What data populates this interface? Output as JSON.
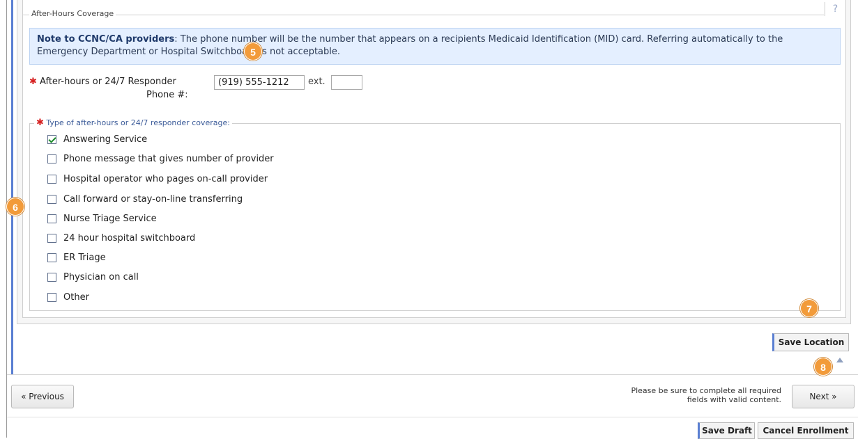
{
  "section": {
    "legend": "After-Hours Coverage",
    "help_icon": "?"
  },
  "note": {
    "lead": "Note to CCNC/CA providers",
    "text": ": The phone number will be the number that appears on a recipients Medicaid Identification (MID) card. Referring automatically to the Emergency Department or Hospital Switchboard is not acceptable."
  },
  "phone": {
    "required_marker": "✱",
    "label_line1": "After-hours or 24/7 Responder",
    "label_line2": "Phone #:",
    "value": "(919) 555-1212",
    "ext_label": "ext.",
    "ext_value": ""
  },
  "coverage_type": {
    "required_marker": "✱",
    "legend": "Type of after-hours or 24/7 responder coverage:",
    "options": [
      {
        "label": "Answering Service",
        "checked": true
      },
      {
        "label": "Phone message that gives number of provider",
        "checked": false
      },
      {
        "label": "Hospital operator who pages on-call provider",
        "checked": false
      },
      {
        "label": "Call forward or stay-on-line transferring",
        "checked": false
      },
      {
        "label": "Nurse Triage Service",
        "checked": false
      },
      {
        "label": "24 hour hospital switchboard",
        "checked": false
      },
      {
        "label": "ER Triage",
        "checked": false
      },
      {
        "label": "Physician on call",
        "checked": false
      },
      {
        "label": "Other",
        "checked": false
      }
    ]
  },
  "callouts": [
    "5",
    "6",
    "7",
    "8"
  ],
  "buttons": {
    "save_location": "Save Location",
    "previous": "« Previous",
    "next": "Next »",
    "save_draft": "Save Draft",
    "cancel_enrollment": "Cancel Enrollment"
  },
  "helper_text": "Please be sure to complete all required fields with valid content.",
  "colors": {
    "accent": "#5a7fd2",
    "callout": "#f29b3a",
    "required": "#d62222",
    "note_bg": "#e4efff"
  },
  "icons": {
    "help": "help-icon",
    "back_to_top": "up-arrow-icon",
    "checkbox_checked": "checkmark-icon"
  }
}
